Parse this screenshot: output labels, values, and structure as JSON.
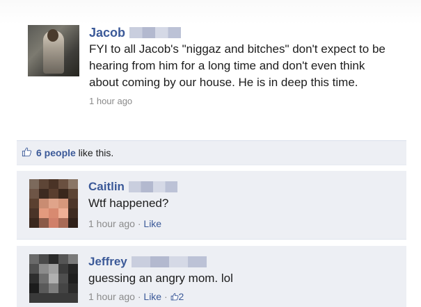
{
  "post": {
    "author": "Jacob",
    "text": "FYI to all Jacob's \"niggaz and bitches\" don't expect to be hearing from him for a long time and don't even think about coming by our house. He is in deep this time.",
    "time": "1 hour ago"
  },
  "likes": {
    "count": "6 people",
    "suffix": " like this."
  },
  "comments": [
    {
      "author": "Caitlin",
      "text": "Wtf happened?",
      "time": "1 hour ago",
      "separator": " · ",
      "like_label": "Like"
    },
    {
      "author": "Jeffrey",
      "text": "guessing an angry mom. lol",
      "time": "1 hour ago",
      "separator": " · ",
      "like_label": "Like",
      "separator2": " · ",
      "like_count": "2"
    }
  ],
  "colors": {
    "link": "#3b5998",
    "comment_bg": "#edeff4",
    "meta_text": "#8a8a8a"
  },
  "icons": {
    "like": "thumbs-up-icon"
  }
}
